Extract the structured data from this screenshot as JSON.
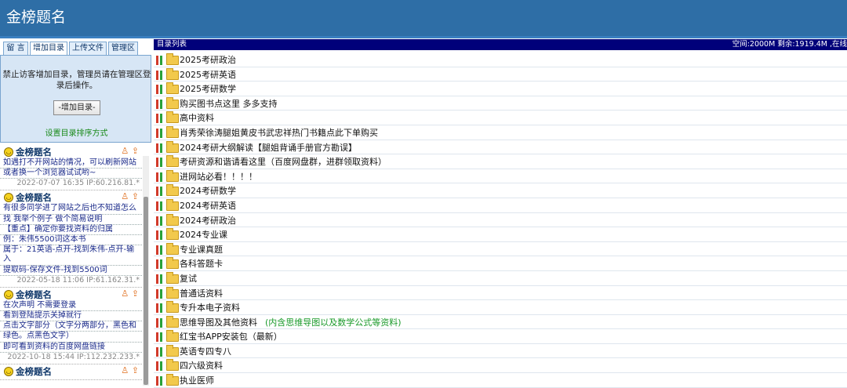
{
  "header": {
    "title": "金榜题名"
  },
  "sidebar": {
    "tabs": [
      "留 言",
      "增加目录",
      "上传文件",
      "管理区"
    ],
    "panel": {
      "note": "禁止访客增加目录，管理员请在管理区登录后操作。",
      "button": "-增加目录-",
      "sort_link": "设置目录排序方式"
    },
    "messages": [
      {
        "user": "金榜题名",
        "lines": [
          "如遇打不开网站的情况，可以刷新网站",
          "或者换一个浏览器试试哟~"
        ],
        "meta": "2022-07-07 16:35 IP:60.216.81.*"
      },
      {
        "user": "金榜题名",
        "lines": [
          "有很多同学进了网站之后也不知道怎么",
          "找 我举个例子 做个简易说明",
          "【重点】确定你要找资料的归属",
          "例：朱伟5500词这本书",
          "属于：21英语-点开-找到朱伟-点开-输入",
          "提取码-保存文件-找到5500词"
        ],
        "meta": "2022-05-18 11:06 IP:61.162.31.*"
      },
      {
        "user": "金榜题名",
        "lines": [
          "在次声明 不需要登录",
          "看到登陆提示关掉就行",
          "点击文字部分（文字分两部分，黑色和",
          "绿色。点黑色文字）",
          "即可看到资料的百度网盘链接"
        ],
        "meta": "2022-10-18 15:44 IP:112.232.233.*"
      },
      {
        "user": "金榜题名",
        "lines": [],
        "meta": ""
      }
    ]
  },
  "main": {
    "bar_left": "目录列表",
    "bar_right": "空间:2000M 剩余:1919.4M ,在线",
    "rows": [
      {
        "name": "2025考研政治",
        "sub": ""
      },
      {
        "name": "2025考研英语",
        "sub": ""
      },
      {
        "name": "2025考研数学",
        "sub": ""
      },
      {
        "name": "购买图书点这里 多多支持",
        "sub": ""
      },
      {
        "name": "高中资料",
        "sub": ""
      },
      {
        "name": "肖秀荣徐涛腿姐黄皮书武忠祥热门书籍点此下单购买",
        "sub": ""
      },
      {
        "name": "2024考研大纲解读【腿姐背诵手册官方勘误】",
        "sub": ""
      },
      {
        "name": "考研资源和谐请看这里（百度网盘群，进群领取资料）",
        "sub": ""
      },
      {
        "name": "进网站必看！！！！",
        "sub": ""
      },
      {
        "name": "2024考研数学",
        "sub": ""
      },
      {
        "name": "2024考研英语",
        "sub": ""
      },
      {
        "name": "2024考研政治",
        "sub": ""
      },
      {
        "name": "2024专业课",
        "sub": ""
      },
      {
        "name": "专业课真题",
        "sub": ""
      },
      {
        "name": "各科答题卡",
        "sub": ""
      },
      {
        "name": "复试",
        "sub": ""
      },
      {
        "name": "普通话资料",
        "sub": ""
      },
      {
        "name": "专升本电子资料",
        "sub": ""
      },
      {
        "name": "思维导图及其他资料",
        "sub": "(内含思维导图以及数学公式等资料)"
      },
      {
        "name": "红宝书APP安装包（最新）",
        "sub": ""
      },
      {
        "name": "英语专四专八",
        "sub": ""
      },
      {
        "name": "四六级资料",
        "sub": ""
      },
      {
        "name": "执业医师",
        "sub": ""
      }
    ]
  }
}
